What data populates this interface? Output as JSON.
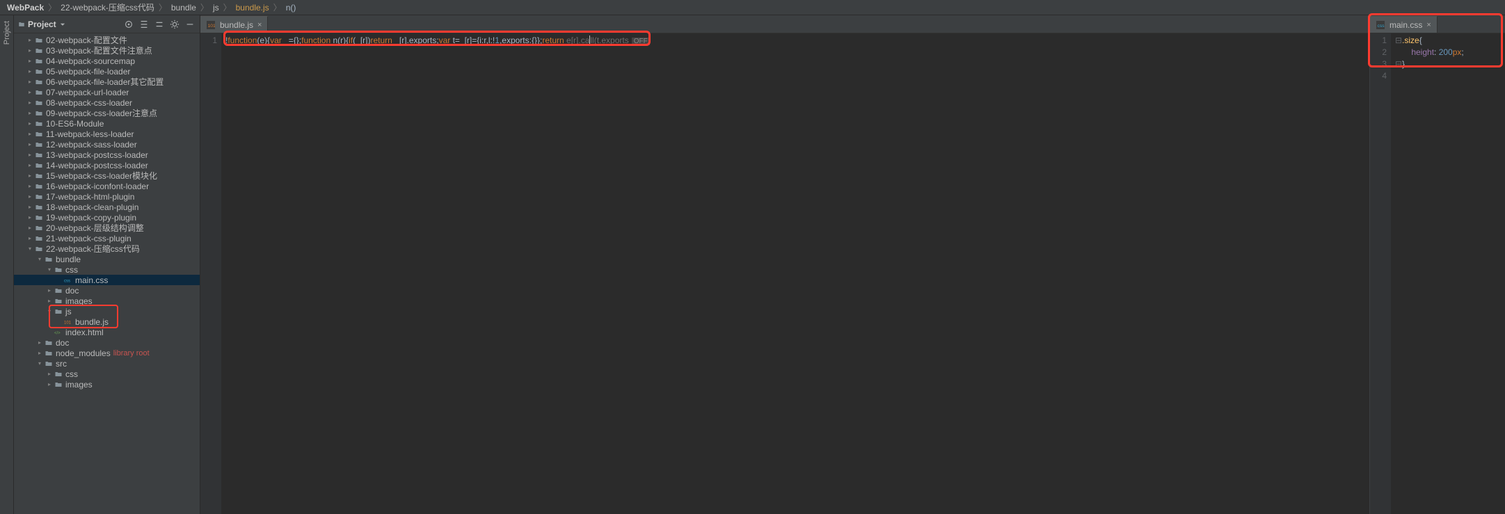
{
  "breadcrumb": {
    "root": "WebPack",
    "parts": [
      "22-webpack-压缩css代码",
      "bundle",
      "js",
      "bundle.js",
      "n()"
    ]
  },
  "sidebar_tab_label": "Project",
  "project_panel": {
    "title": "Project",
    "toolbar_icons": [
      "scroll-to-icon",
      "collapse-icon",
      "expand-icon",
      "gear-icon",
      "hide-icon"
    ]
  },
  "tree": [
    {
      "depth": 1,
      "chev": ">",
      "icon": "folder",
      "label": "02-webpack-配置文件"
    },
    {
      "depth": 1,
      "chev": ">",
      "icon": "folder",
      "label": "03-webpack-配置文件注意点"
    },
    {
      "depth": 1,
      "chev": ">",
      "icon": "folder",
      "label": "04-webpack-sourcemap"
    },
    {
      "depth": 1,
      "chev": ">",
      "icon": "folder",
      "label": "05-webpack-file-loader"
    },
    {
      "depth": 1,
      "chev": ">",
      "icon": "folder",
      "label": "06-webpack-file-loader其它配置"
    },
    {
      "depth": 1,
      "chev": ">",
      "icon": "folder",
      "label": "07-webpack-url-loader"
    },
    {
      "depth": 1,
      "chev": ">",
      "icon": "folder",
      "label": "08-webpack-css-loader"
    },
    {
      "depth": 1,
      "chev": ">",
      "icon": "folder",
      "label": "09-webpack-css-loader注意点"
    },
    {
      "depth": 1,
      "chev": ">",
      "icon": "folder",
      "label": "10-ES6-Module"
    },
    {
      "depth": 1,
      "chev": ">",
      "icon": "folder",
      "label": "11-webpack-less-loader"
    },
    {
      "depth": 1,
      "chev": ">",
      "icon": "folder",
      "label": "12-webpack-sass-loader"
    },
    {
      "depth": 1,
      "chev": ">",
      "icon": "folder",
      "label": "13-webpack-postcss-loader"
    },
    {
      "depth": 1,
      "chev": ">",
      "icon": "folder",
      "label": "14-webpack-postcss-loader"
    },
    {
      "depth": 1,
      "chev": ">",
      "icon": "folder",
      "label": "15-webpack-css-loader模块化"
    },
    {
      "depth": 1,
      "chev": ">",
      "icon": "folder",
      "label": "16-webpack-iconfont-loader"
    },
    {
      "depth": 1,
      "chev": ">",
      "icon": "folder",
      "label": "17-webpack-html-plugin"
    },
    {
      "depth": 1,
      "chev": ">",
      "icon": "folder",
      "label": "18-webpack-clean-plugin"
    },
    {
      "depth": 1,
      "chev": ">",
      "icon": "folder",
      "label": "19-webpack-copy-plugin"
    },
    {
      "depth": 1,
      "chev": ">",
      "icon": "folder",
      "label": "20-webpack-层级结构调整"
    },
    {
      "depth": 1,
      "chev": ">",
      "icon": "folder",
      "label": "21-webpack-css-plugin"
    },
    {
      "depth": 1,
      "chev": "v",
      "icon": "folder",
      "label": "22-webpack-压缩css代码"
    },
    {
      "depth": 2,
      "chev": "v",
      "icon": "folder",
      "label": "bundle"
    },
    {
      "depth": 3,
      "chev": "v",
      "icon": "folder",
      "label": "css"
    },
    {
      "depth": 4,
      "chev": "",
      "icon": "css",
      "label": "main.css",
      "selected": true
    },
    {
      "depth": 3,
      "chev": ">",
      "icon": "folder",
      "label": "doc"
    },
    {
      "depth": 3,
      "chev": ">",
      "icon": "folder",
      "label": "images"
    },
    {
      "depth": 3,
      "chev": "v",
      "icon": "folder",
      "label": "js"
    },
    {
      "depth": 4,
      "chev": "",
      "icon": "js",
      "label": "bundle.js"
    },
    {
      "depth": 3,
      "chev": "",
      "icon": "html",
      "label": "index.html"
    },
    {
      "depth": 2,
      "chev": ">",
      "icon": "folder",
      "label": "doc"
    },
    {
      "depth": 2,
      "chev": ">",
      "icon": "folder",
      "label": "node_modules",
      "note": "library root"
    },
    {
      "depth": 2,
      "chev": "v",
      "icon": "folder",
      "label": "src"
    },
    {
      "depth": 3,
      "chev": ">",
      "icon": "folder",
      "label": "css"
    },
    {
      "depth": 3,
      "chev": ">",
      "icon": "folder",
      "label": "images"
    }
  ],
  "editors": {
    "left": {
      "tab_label": "bundle.js",
      "tab_icon": "js",
      "lines": [
        "1"
      ],
      "off_label": "OFF",
      "code_tokens": [
        {
          "t": "!",
          "c": "pun"
        },
        {
          "t": "function",
          "c": "kw"
        },
        {
          "t": "(e){",
          "c": "pun"
        },
        {
          "t": "var",
          "c": "kw"
        },
        {
          "t": " _={};",
          "c": "pun"
        },
        {
          "t": "function",
          "c": "kw"
        },
        {
          "t": " n(r){",
          "c": "pun"
        },
        {
          "t": "if",
          "c": "kw"
        },
        {
          "t": "(_[r])",
          "c": "pun"
        },
        {
          "t": "return",
          "c": "kw"
        },
        {
          "t": " _[r].exports;",
          "c": "pun"
        },
        {
          "t": "var",
          "c": "kw"
        },
        {
          "t": " t=_[r]={i:r,l:!",
          "c": "pun"
        },
        {
          "t": "1",
          "c": "num"
        },
        {
          "t": ",exports:{}};",
          "c": "pun"
        },
        {
          "t": "return",
          "c": "kw"
        },
        {
          "t": " e[r].ca",
          "c": "fade"
        },
        {
          "t": "",
          "c": "cursor"
        },
        {
          "t": "ll(t.exports",
          "c": "fade"
        }
      ]
    },
    "right": {
      "tab_label": "main.css",
      "tab_icon": "css",
      "lines": [
        "1",
        "2",
        "3",
        "4"
      ],
      "code_rows": [
        [
          {
            "t": ".size",
            "c": "sel"
          },
          {
            "t": "{",
            "c": "pun"
          }
        ],
        [
          {
            "t": "    height",
            "c": "prop"
          },
          {
            "t": ": ",
            "c": "pun"
          },
          {
            "t": "200",
            "c": "num"
          },
          {
            "t": "px",
            "c": "kw"
          },
          {
            "t": ";",
            "c": "pun"
          }
        ],
        [
          {
            "t": "}",
            "c": "pun"
          }
        ],
        [
          {
            "t": "",
            "c": "pun"
          }
        ]
      ]
    }
  }
}
